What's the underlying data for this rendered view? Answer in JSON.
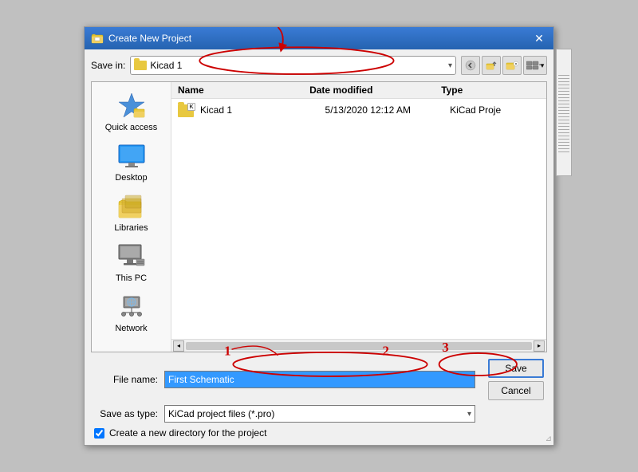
{
  "dialog": {
    "title": "Create New Project",
    "title_icon": "📁"
  },
  "save_in": {
    "label": "Save in:",
    "current_folder": "Kicad 1"
  },
  "toolbar": {
    "back_label": "←",
    "up_label": "↑",
    "new_folder_label": "📁",
    "menu_label": "▾"
  },
  "file_list": {
    "columns": {
      "name": "Name",
      "date_modified": "Date modified",
      "type": "Type"
    },
    "items": [
      {
        "name": "Kicad 1",
        "date_modified": "5/13/2020 12:12 AM",
        "type": "KiCad Proje"
      }
    ]
  },
  "sidebar": {
    "items": [
      {
        "label": "Quick access"
      },
      {
        "label": "Desktop"
      },
      {
        "label": "Libraries"
      },
      {
        "label": "This PC"
      },
      {
        "label": "Network"
      }
    ]
  },
  "bottom": {
    "file_name_label": "File name:",
    "file_name_value": "First Schematic",
    "save_as_type_label": "Save as type:",
    "save_as_type_value": "KiCad project files (*.pro)",
    "save_button": "Save",
    "cancel_button": "Cancel",
    "checkbox_label": "Create a new directory for the project"
  },
  "annotations": {
    "numbers": [
      "1",
      "2",
      "3"
    ]
  }
}
